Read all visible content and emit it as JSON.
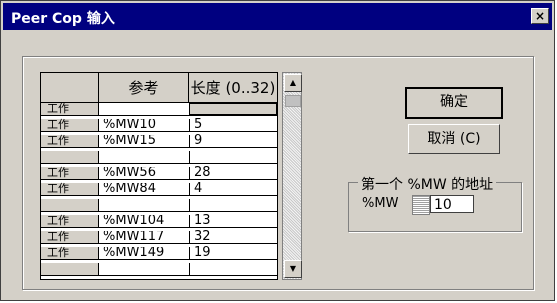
{
  "window": {
    "title": "Peer Cop 输入",
    "close_icon": "close-icon"
  },
  "table": {
    "headers": {
      "reference": "参考",
      "length": "长度 (0..32)"
    },
    "rows": [
      {
        "label": "工作",
        "ref": "",
        "len": "",
        "selected": true
      },
      {
        "label": "工作",
        "ref": "%MW10",
        "len": "5"
      },
      {
        "label": "工作",
        "ref": "%MW15",
        "len": "9"
      },
      {
        "label": "",
        "ref": "",
        "len": ""
      },
      {
        "label": "工作",
        "ref": "%MW56",
        "len": "28"
      },
      {
        "label": "工作",
        "ref": "%MW84",
        "len": "4"
      },
      {
        "label": "",
        "ref": "",
        "len": ""
      },
      {
        "label": "工作",
        "ref": "%MW104",
        "len": "13"
      },
      {
        "label": "工作",
        "ref": "%MW117",
        "len": "32"
      },
      {
        "label": "工作",
        "ref": "%MW149",
        "len": "19"
      },
      {
        "label": "",
        "ref": "",
        "len": ""
      }
    ]
  },
  "buttons": {
    "ok": "确定",
    "cancel": "取消 (C)"
  },
  "address_group": {
    "title": "第一个 %MW 的地址",
    "label": "%MW",
    "value": "10"
  }
}
